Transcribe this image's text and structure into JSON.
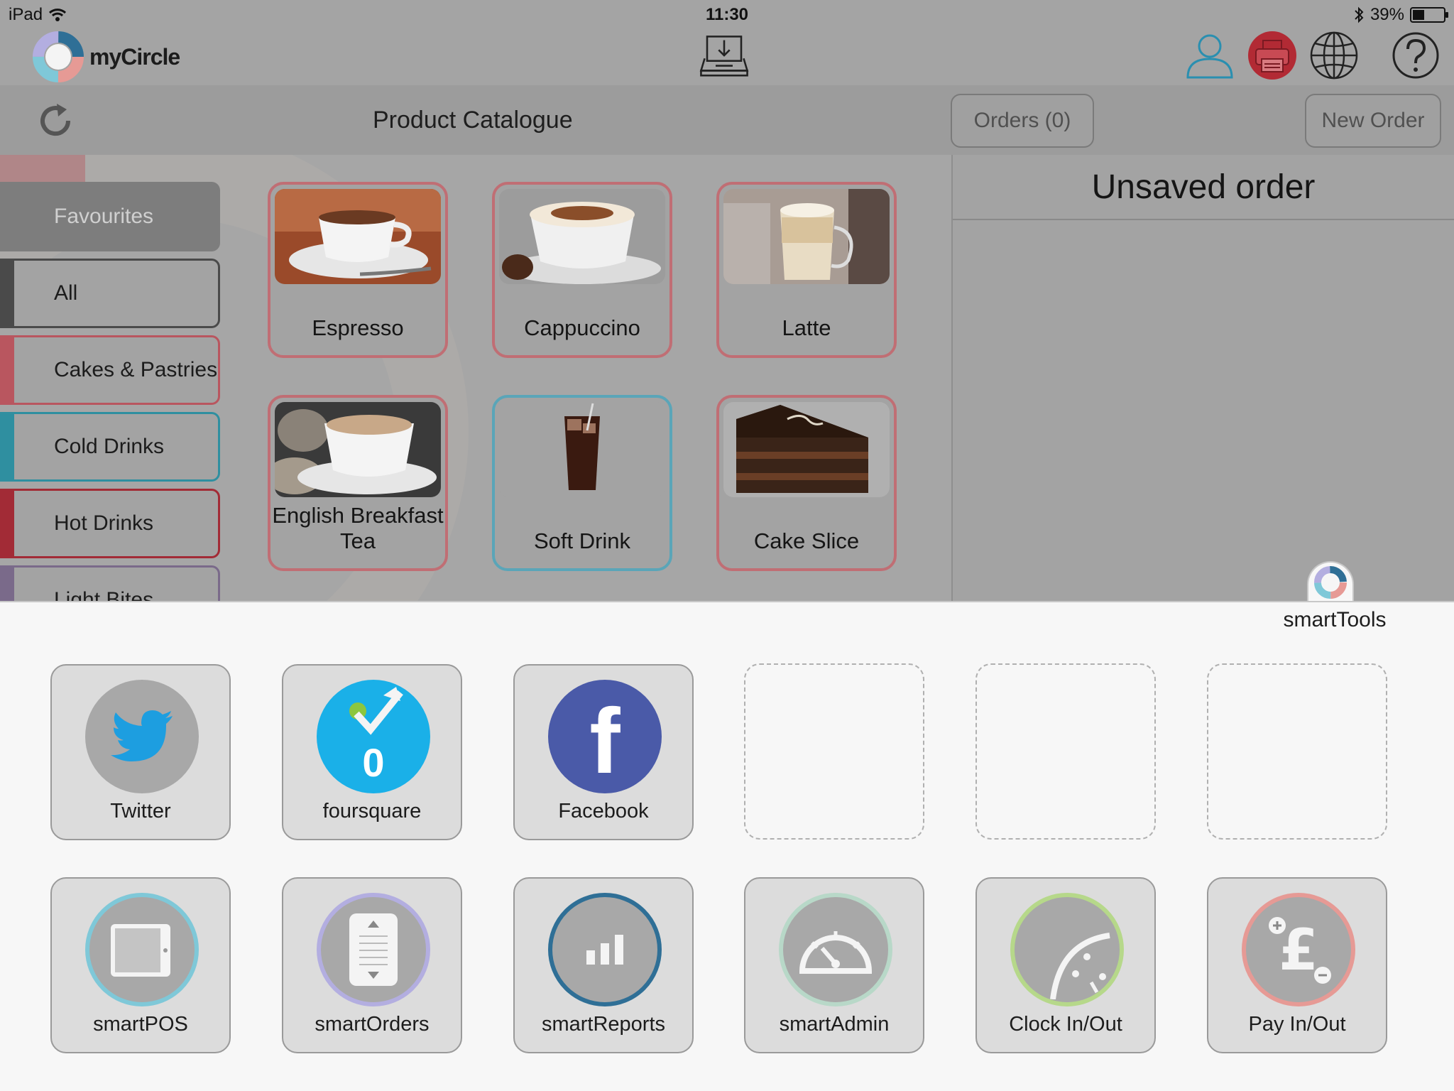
{
  "status": {
    "device": "iPad",
    "time": "11:30",
    "battery": "39%",
    "battery_level": 0.39
  },
  "app": {
    "name": "myCircle"
  },
  "toolbar": {
    "title": "Product Catalogue",
    "orders_label": "Orders (0)",
    "new_order_label": "New Order"
  },
  "categories": [
    {
      "label": "Favourites",
      "color": "#7d7d7d"
    },
    {
      "label": "All",
      "color": "#4a4a4a"
    },
    {
      "label": "Cakes & Pastries",
      "color": "#b9565f"
    },
    {
      "label": "Cold Drinks",
      "color": "#2f8fa0"
    },
    {
      "label": "Hot Drinks",
      "color": "#a22b36"
    },
    {
      "label": "Light Bites",
      "color": "#7a6a8a"
    }
  ],
  "products": [
    {
      "label": "Espresso",
      "border": "#c06e74"
    },
    {
      "label": "Cappuccino",
      "border": "#c06e74"
    },
    {
      "label": "Latte",
      "border": "#c06e74"
    },
    {
      "label": "English Breakfast Tea",
      "border": "#c06e74"
    },
    {
      "label": "Soft Drink",
      "border": "#5aa5b8"
    },
    {
      "label": "Cake Slice",
      "border": "#c06e74"
    }
  ],
  "order": {
    "title": "Unsaved order"
  },
  "tray": {
    "title": "smartTools",
    "social": [
      {
        "label": "Twitter",
        "icon": "twitter-icon"
      },
      {
        "label": "foursquare",
        "icon": "foursquare-icon",
        "count": "0"
      },
      {
        "label": "Facebook",
        "icon": "facebook-icon"
      }
    ],
    "tools": [
      {
        "label": "smartPOS",
        "ring": "#7fc8d8"
      },
      {
        "label": "smartOrders",
        "ring": "#b3aee0"
      },
      {
        "label": "smartReports",
        "ring": "#2f6f96"
      },
      {
        "label": "smartAdmin",
        "ring": "#b8d8c8"
      },
      {
        "label": "Clock In/Out",
        "ring": "#b6d88a"
      },
      {
        "label": "Pay In/Out",
        "ring": "#e69a95"
      }
    ]
  }
}
